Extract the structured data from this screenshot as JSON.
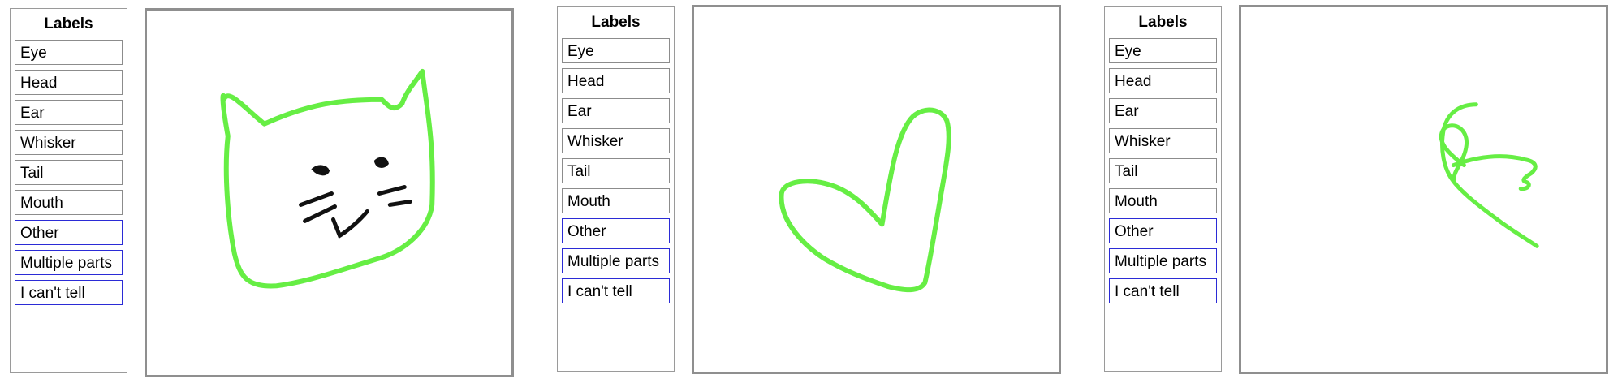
{
  "panels": [
    {
      "labels_title": "Labels",
      "labels": [
        "Eye",
        "Head",
        "Ear",
        "Whisker",
        "Tail",
        "Mouth"
      ],
      "special_labels": [
        "Other",
        "Multiple parts",
        "I can't tell"
      ]
    },
    {
      "labels_title": "Labels",
      "labels": [
        "Eye",
        "Head",
        "Ear",
        "Whisker",
        "Tail",
        "Mouth"
      ],
      "special_labels": [
        "Other",
        "Multiple parts",
        "I can't tell"
      ]
    },
    {
      "labels_title": "Labels",
      "labels": [
        "Eye",
        "Head",
        "Ear",
        "Whisker",
        "Tail",
        "Mouth"
      ],
      "special_labels": [
        "Other",
        "Multiple parts",
        "I can't tell"
      ]
    }
  ],
  "colors": {
    "stroke_green": "#66ee44",
    "stroke_black": "#111111",
    "special_border": "#2b2bd6"
  }
}
